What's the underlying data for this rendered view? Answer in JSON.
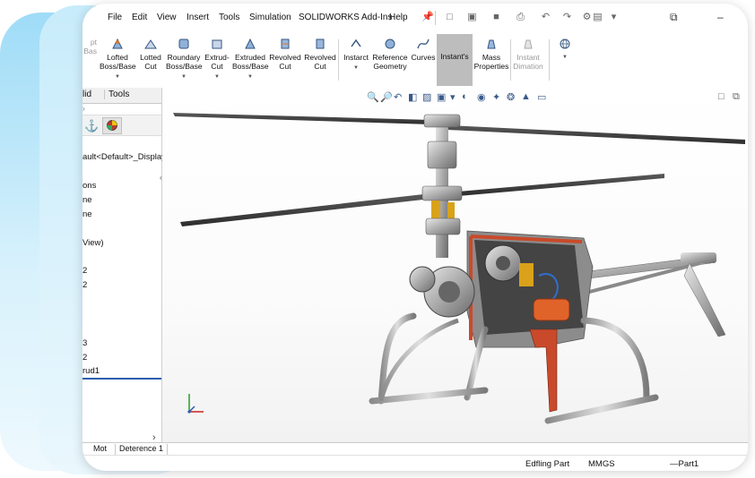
{
  "menu": {
    "items": [
      "File",
      "Edit",
      "View",
      "Insert",
      "Tools",
      "Simulation",
      "SOLIDWORKS Add-Ins",
      "Help"
    ]
  },
  "quick_access_icons": [
    "pin-icon",
    "new-document-icon",
    "open-icon",
    "save-icon",
    "print-icon",
    "undo-icon",
    "redo-icon",
    "rebuild-icon",
    "options-icon"
  ],
  "ribbon": {
    "partial_first": "pt\nBas",
    "buttons": [
      {
        "name": "lofted-boss-base",
        "label": "Lofted\nBoss/Base"
      },
      {
        "name": "lofted-cut",
        "label": "Lotted\nCut"
      },
      {
        "name": "boundary-boss-base",
        "label": "Roundary\nBoss/Base"
      },
      {
        "name": "extruded-cut",
        "label": "Extrud-\nCut"
      },
      {
        "name": "extruded-boss-base",
        "label": "Extruded\nBoss/Base"
      },
      {
        "name": "revolved-cut",
        "label": "Revolved\nCut"
      },
      {
        "name": "revolved-cut-2",
        "label": "Revolved\nCut"
      },
      {
        "name": "instant3d",
        "label": "Instarct"
      },
      {
        "name": "reference-geometry",
        "label": "Reference\nGeometry"
      },
      {
        "name": "curves",
        "label": "Curves"
      },
      {
        "name": "instants",
        "label": "Instant's"
      },
      {
        "name": "mass-properties",
        "label": "Mass\nProperties"
      },
      {
        "name": "instant-dimension",
        "label": "Instant\nDimation"
      }
    ]
  },
  "sidebar": {
    "tabs": [
      "lid",
      "Tools"
    ],
    "tree": [
      "ault<Default>_Display",
      "ons",
      "ne",
      "ne",
      "View)",
      "2",
      "2",
      "3",
      "2",
      "rud1"
    ]
  },
  "bottom_tabs": [
    "Mot",
    "Deterence 1"
  ],
  "status": {
    "doc_type": "Edfling Part",
    "units": "MMGS",
    "part": "—Part1"
  },
  "window_controls": [
    "restore-icon",
    "minimize-icon"
  ],
  "colors": {
    "accent": "#2a5db0",
    "active_button": "#bdbdbd",
    "deco": "#9fdcf7"
  }
}
